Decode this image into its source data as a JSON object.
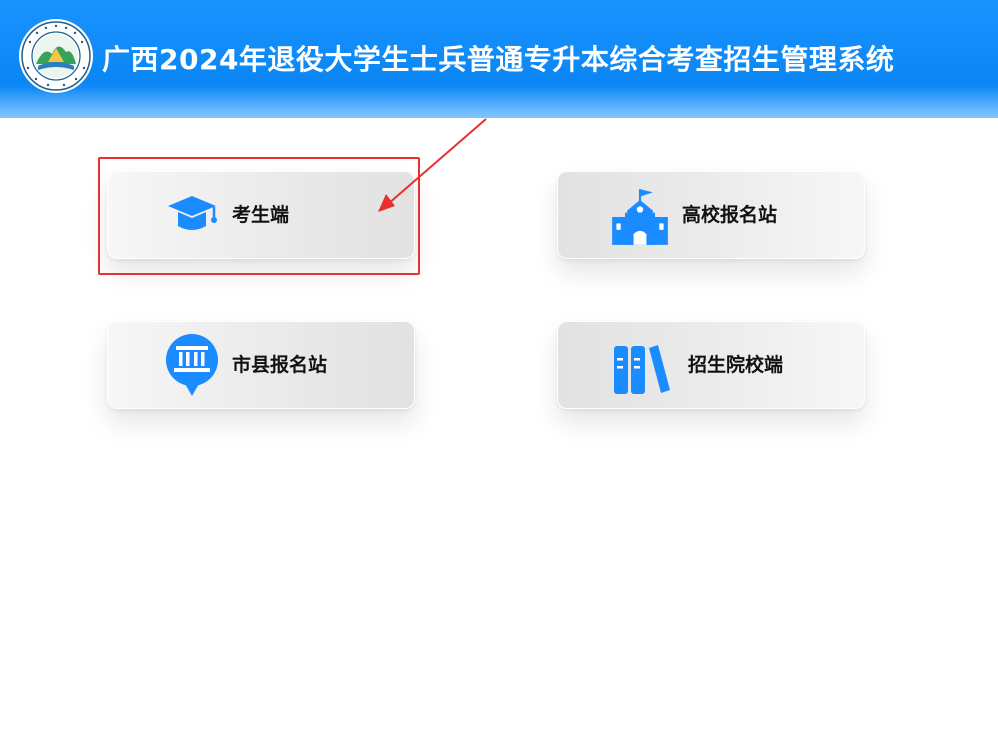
{
  "header": {
    "title": "广西2024年退役大学生士兵普通专升本综合考查招生管理系统",
    "logo_icon": "university-seal-logo"
  },
  "cards": {
    "student": {
      "label": "考生端",
      "icon": "graduation-cap-icon"
    },
    "university_site": {
      "label": "高校报名站",
      "icon": "school-building-icon"
    },
    "city_site": {
      "label": "市县报名站",
      "icon": "government-building-pin-icon"
    },
    "admission_school": {
      "label": "招生院校端",
      "icon": "books-icon"
    }
  },
  "annotation": {
    "highlight_color": "#e8302f",
    "arrow_color": "#e8302f"
  },
  "colors": {
    "header_blue": "#0a86f4",
    "icon_blue": "#1a8cff"
  }
}
